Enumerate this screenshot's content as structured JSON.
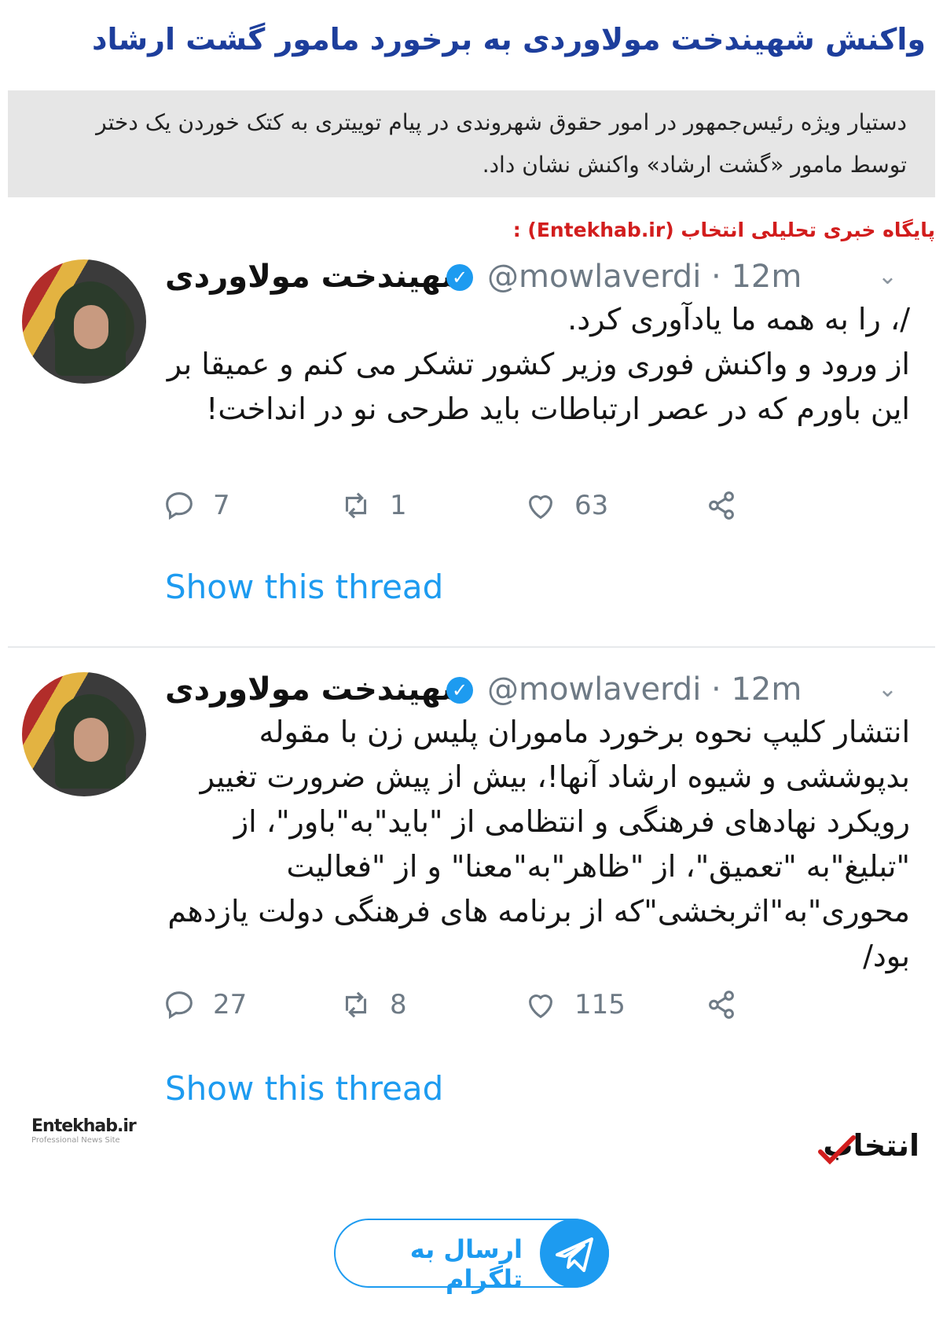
{
  "article": {
    "headline": "واکنش شهیندخت مولاوردی به برخورد مامور گشت ارشاد",
    "lead": "دستیار ویژه رئیس‌جمهور در امور حقوق شهروندی در پیام توییتری به کتک خوردن یک دختر توسط مامور «گشت ارشاد» واکنش نشان داد.",
    "source": "پایگاه خبری تحلیلی انتخاب (Entekhab.ir) :"
  },
  "tweets": [
    {
      "name": "شهیندخت مولاوردی",
      "handle": "@mowlaverdi · 12m",
      "text": "/، را به همه ما یادآوری کرد.\nاز ورود و واکنش فوری وزیر کشور تشکر می کنم و عمیقا بر این باورم که در عصر ارتباطات باید طرحی نو در انداخت!",
      "replies": "7",
      "retweets": "1",
      "likes": "63",
      "show_thread": "Show this thread"
    },
    {
      "name": "شهیندخت مولاوردی",
      "handle": "@mowlaverdi · 12m",
      "text": "انتشار کلیپ نحوه برخورد ماموران پلیس زن با مقوله بدپوششی و شیوه ارشاد آنها!، بیش از پیش ضرورت تغییر رویکرد نهادهای فرهنگی و انتظامی از \"باید\"به\"باور\"، از \"تبلیغ\"به \"تعمیق\"، از \"ظاهر\"به\"معنا\" و از \"فعالیت محوری\"به\"اثربخشی\"که از برنامه های فرهنگی دولت یازدهم بود/",
      "replies": "27",
      "retweets": "8",
      "likes": "115",
      "show_thread": "Show this thread"
    }
  ],
  "watermarks": {
    "left": "Entekhab.ir",
    "left_sub": "Professional News Site",
    "right": "انتخاب"
  },
  "share": {
    "telegram_label": "ارسال به تلگرام"
  },
  "colors": {
    "headline": "#1d3e9c",
    "source": "#d21d1d",
    "twitter_blue": "#1d9bf0",
    "muted": "#6e7a85",
    "lead_bg": "#e6e6e6"
  },
  "icons": [
    "reply-icon",
    "retweet-icon",
    "like-icon",
    "share-icon",
    "verified-badge-icon",
    "chevron-down-icon",
    "telegram-plane-icon"
  ]
}
